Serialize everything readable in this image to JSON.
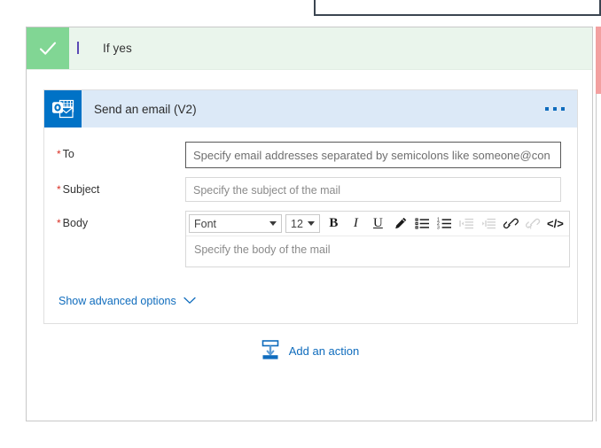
{
  "branch": {
    "title": "If yes",
    "check_icon": "checkmark-icon",
    "accent_green": "#81d694",
    "header_bg": "#eaf5ec"
  },
  "action_card": {
    "title": "Send an email (V2)",
    "icon": "outlook-icon",
    "icon_bg": "#0072c6",
    "header_bg": "#dce9f7",
    "menu_label": "...",
    "fields": [
      {
        "label": "To",
        "required_marker": "*",
        "placeholder": "Specify email addresses separated by semicolons like someone@con",
        "type": "text",
        "focused": true
      },
      {
        "label": "Subject",
        "required_marker": "*",
        "placeholder": "Specify the subject of the mail",
        "type": "text",
        "focused": false
      },
      {
        "label": "Body",
        "required_marker": "*",
        "placeholder": "Specify the body of the mail",
        "type": "richtext",
        "focused": false
      }
    ],
    "rte_toolbar": {
      "font_name": "Font",
      "font_size": "12",
      "buttons": [
        {
          "name": "bold-icon",
          "glyph": "B",
          "disabled": false
        },
        {
          "name": "italic-icon",
          "glyph": "I",
          "disabled": false
        },
        {
          "name": "underline-icon",
          "glyph": "U",
          "disabled": false
        },
        {
          "name": "highlighter-icon",
          "glyph": "pen",
          "disabled": false
        },
        {
          "name": "bulleted-list-icon",
          "glyph": "bullets",
          "disabled": false
        },
        {
          "name": "numbered-list-icon",
          "glyph": "numbers",
          "disabled": false
        },
        {
          "name": "decrease-indent-icon",
          "glyph": "outdent",
          "disabled": true
        },
        {
          "name": "increase-indent-icon",
          "glyph": "indent",
          "disabled": true
        },
        {
          "name": "link-icon",
          "glyph": "link",
          "disabled": false
        },
        {
          "name": "unlink-icon",
          "glyph": "unlink",
          "disabled": true
        },
        {
          "name": "code-view-icon",
          "glyph": "</>",
          "disabled": false
        }
      ]
    },
    "advanced_options": {
      "label": "Show advanced options",
      "chevron": "chevron-down-icon",
      "color": "#0f6cbd"
    }
  },
  "add_action": {
    "label": "Add an action",
    "icon": "add-action-icon",
    "color": "#0f6cbd"
  },
  "colors": {
    "accent_blue": "#0f6cbd",
    "error_red": "#f3a0a0",
    "card_border": "#c8c8c8",
    "dark_box_border": "#3b4551"
  }
}
